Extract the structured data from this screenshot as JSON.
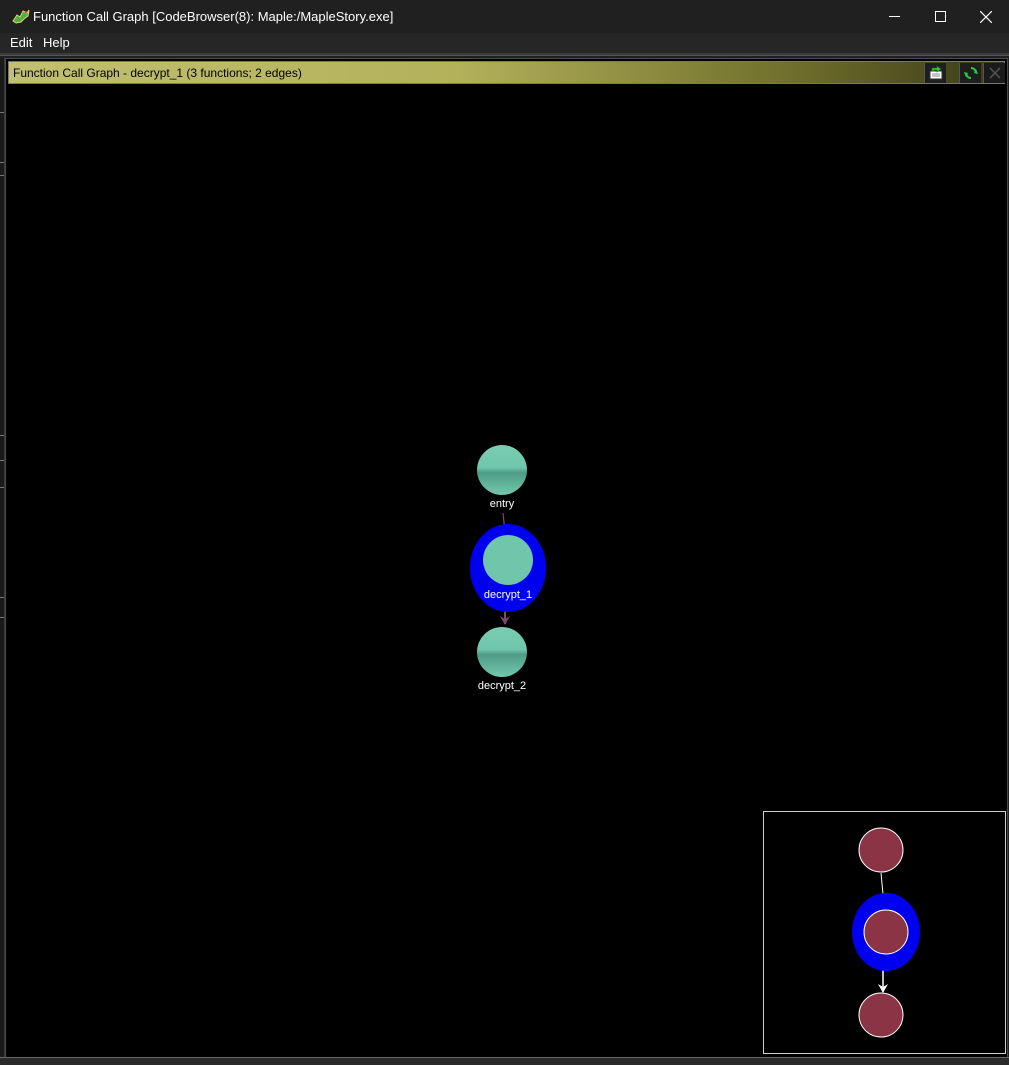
{
  "window": {
    "title": "Function Call Graph [CodeBrowser(8): Maple:/MapleStory.exe]",
    "controls": {
      "minimize": "minimize",
      "maximize": "maximize",
      "close": "close"
    }
  },
  "menu": {
    "items": [
      "Edit",
      "Help"
    ]
  },
  "panel": {
    "title": "Function Call Graph - decrypt_1 (3 functions; 2 edges)",
    "buttons": [
      "export-icon",
      "refresh-icon",
      "close-icon"
    ]
  },
  "graph": {
    "nodes": [
      {
        "id": "entry",
        "label": "entry",
        "selected": false
      },
      {
        "id": "decrypt_1",
        "label": "decrypt_1",
        "selected": true
      },
      {
        "id": "decrypt_2",
        "label": "decrypt_2",
        "selected": false
      }
    ],
    "edges": [
      {
        "from": "entry",
        "to": "decrypt_1"
      },
      {
        "from": "decrypt_1",
        "to": "decrypt_2"
      }
    ],
    "colors": {
      "node_fill": "#6fc6ab",
      "selection_ring": "#0000f0",
      "edge": "#7a4a6a",
      "satellite_node": "#8a3446"
    }
  }
}
